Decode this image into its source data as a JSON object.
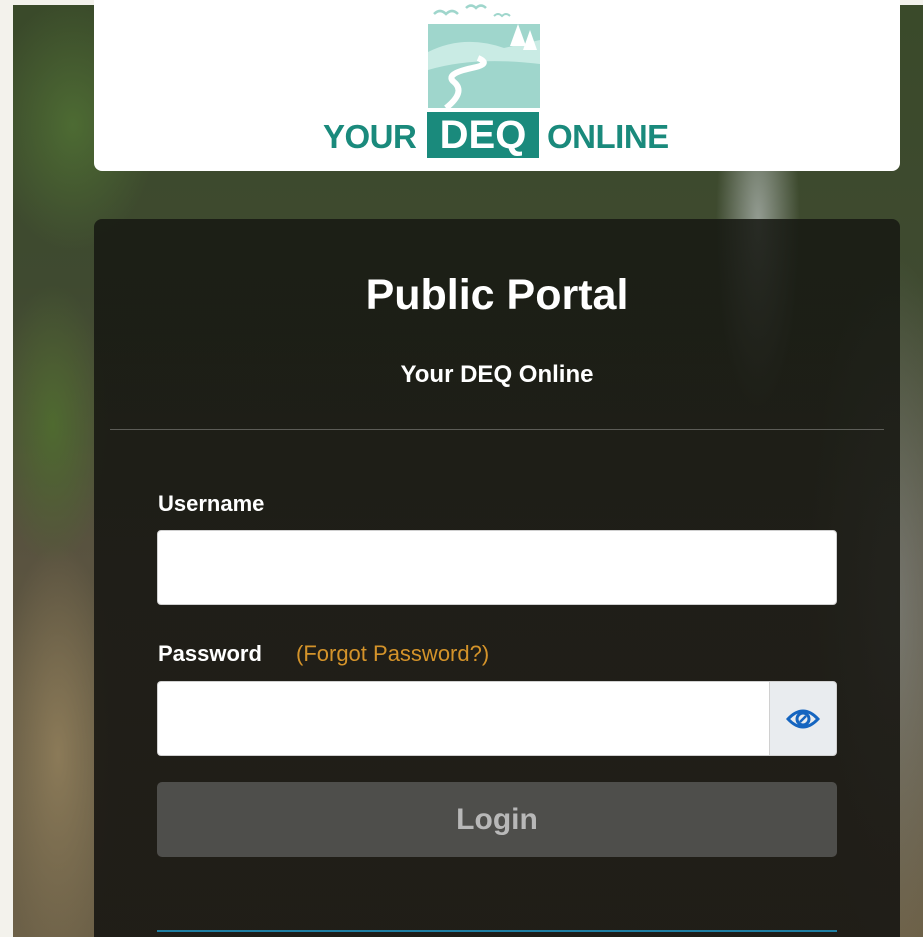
{
  "logo": {
    "word_left": "YOUR",
    "word_box": "DEQ",
    "word_right": "ONLINE",
    "brand_color": "#1a8a7c",
    "light_color": "#9fd6cc"
  },
  "login": {
    "title": "Public Portal",
    "subtitle": "Your DEQ Online",
    "username_label": "Username",
    "username_value": "",
    "password_label": "Password",
    "forgot_link": "(Forgot Password?)",
    "password_value": "",
    "show_password_icon": "eye-icon",
    "login_button": "Login"
  },
  "colors": {
    "accent_link": "#d4932a",
    "eye_icon": "#1565c0",
    "bottom_rule": "#1f7fa3"
  }
}
